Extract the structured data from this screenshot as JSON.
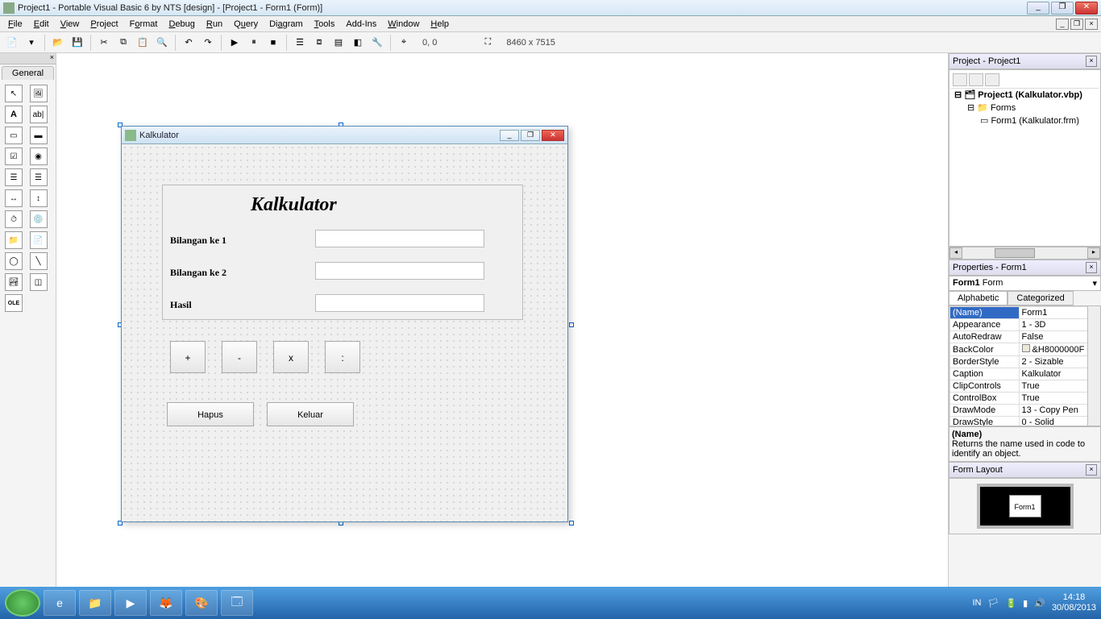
{
  "window": {
    "title": "Project1 - Portable Visual Basic 6 by NTS [design] - [Project1 - Form1 (Form)]"
  },
  "menu": {
    "items": [
      "File",
      "Edit",
      "View",
      "Project",
      "Format",
      "Debug",
      "Run",
      "Query",
      "Diagram",
      "Tools",
      "Add-Ins",
      "Window",
      "Help"
    ]
  },
  "toolbar": {
    "coords": "0, 0",
    "size": "8460 x 7515"
  },
  "toolbox": {
    "tab": "General"
  },
  "form": {
    "title": "Kalkulator",
    "heading": "Kalkulator",
    "label1": "Bilangan ke 1",
    "label2": "Bilangan ke 2",
    "label3": "Hasil",
    "btn_plus": "+",
    "btn_minus": "-",
    "btn_mul": "x",
    "btn_div": ":",
    "btn_clear": "Hapus",
    "btn_exit": "Keluar"
  },
  "project": {
    "title": "Project - Project1",
    "root": "Project1 (Kalkulator.vbp)",
    "folder": "Forms",
    "item": "Form1 (Kalkulator.frm)"
  },
  "properties": {
    "title": "Properties - Form1",
    "object": "Form1",
    "objtype": "Form",
    "tab_alpha": "Alphabetic",
    "tab_cat": "Categorized",
    "rows": [
      {
        "k": "(Name)",
        "v": "Form1"
      },
      {
        "k": "Appearance",
        "v": "1 - 3D"
      },
      {
        "k": "AutoRedraw",
        "v": "False"
      },
      {
        "k": "BackColor",
        "v": "&H8000000F"
      },
      {
        "k": "BorderStyle",
        "v": "2 - Sizable"
      },
      {
        "k": "Caption",
        "v": "Kalkulator"
      },
      {
        "k": "ClipControls",
        "v": "True"
      },
      {
        "k": "ControlBox",
        "v": "True"
      },
      {
        "k": "DrawMode",
        "v": "13 - Copy Pen"
      },
      {
        "k": "DrawStyle",
        "v": "0 - Solid"
      }
    ],
    "desc_title": "(Name)",
    "desc_text": "Returns the name used in code to identify an object."
  },
  "layout": {
    "title": "Form Layout",
    "mini": "Form1"
  },
  "tray": {
    "lang": "IN",
    "time": "14:18",
    "date": "30/08/2013"
  }
}
